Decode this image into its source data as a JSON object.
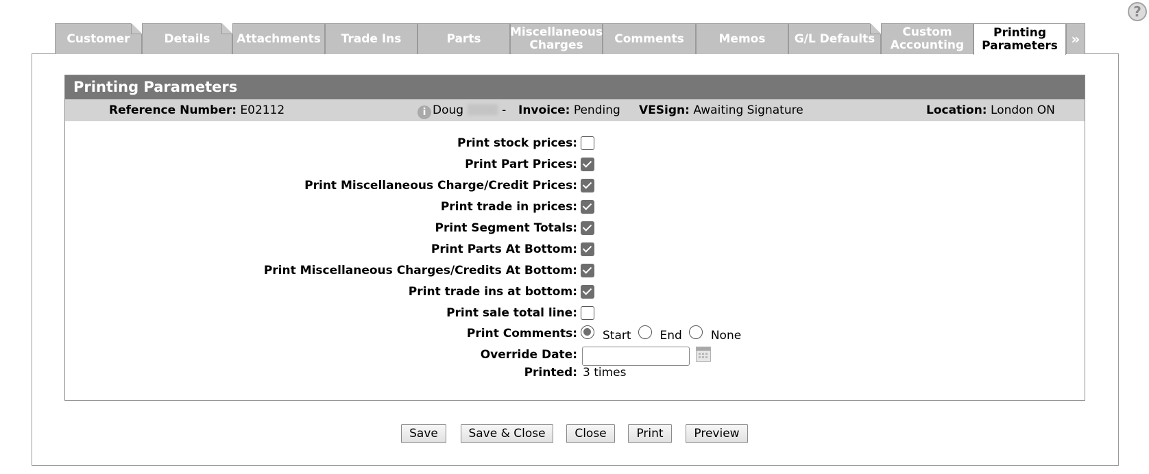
{
  "tabs": [
    {
      "label": "Customer",
      "folded": true
    },
    {
      "label": "Details",
      "folded": true
    },
    {
      "label": "Attachments"
    },
    {
      "label": "Trade Ins"
    },
    {
      "label": "Parts"
    },
    {
      "label": "Miscellaneous Charges"
    },
    {
      "label": "Comments"
    },
    {
      "label": "Memos"
    },
    {
      "label": "G/L Defaults",
      "folded": true
    },
    {
      "label": "Custom Accounting"
    },
    {
      "label": "Printing Parameters",
      "active": true
    },
    {
      "label": "»"
    }
  ],
  "panel": {
    "title": "Printing Parameters",
    "info": {
      "reference_label": "Reference Number:",
      "reference_value": "E02112",
      "info_icon": "info-icon",
      "customer_name": "Doug",
      "separator": "-",
      "invoice_label": "Invoice:",
      "invoice_value": "Pending",
      "vesign_label": "VESign:",
      "vesign_value": "Awaiting Signature",
      "location_label": "Location:",
      "location_value": "London ON"
    }
  },
  "form": {
    "print_stock_prices": {
      "label": "Print stock prices:",
      "checked": false
    },
    "print_part_prices": {
      "label": "Print Part Prices:",
      "checked": true
    },
    "print_misc_prices": {
      "label": "Print Miscellaneous Charge/Credit Prices:",
      "checked": true
    },
    "print_trade_in_prices": {
      "label": "Print trade in prices:",
      "checked": true
    },
    "print_segment_totals": {
      "label": "Print Segment Totals:",
      "checked": true
    },
    "print_parts_bottom": {
      "label": "Print Parts At Bottom:",
      "checked": true
    },
    "print_misc_bottom": {
      "label": "Print Miscellaneous Charges/Credits At Bottom:",
      "checked": true
    },
    "print_trade_ins_bottom": {
      "label": "Print trade ins at bottom:",
      "checked": true
    },
    "print_sale_total": {
      "label": "Print sale total line:",
      "checked": false
    },
    "print_comments": {
      "label": "Print Comments:",
      "options": [
        "Start",
        "End",
        "None"
      ],
      "selected": "Start"
    },
    "override_date": {
      "label": "Override Date:",
      "value": ""
    },
    "printed": {
      "label": "Printed:",
      "value": "3 times"
    }
  },
  "buttons": {
    "save": "Save",
    "save_close": "Save & Close",
    "close": "Close",
    "print": "Print",
    "preview": "Preview"
  },
  "help_icon": "?"
}
